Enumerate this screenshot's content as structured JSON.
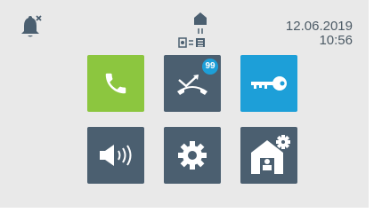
{
  "status": {
    "date": "12.06.2019",
    "time": "10:56"
  },
  "colors": {
    "call": "#8cc63f",
    "tile": "#4b5f70",
    "door": "#1d9fd8",
    "screen": "#e9e9e9"
  },
  "icons": {
    "notification": "bell-muted-icon",
    "connection": "building-link-icon",
    "call": "phone-icon",
    "missed_calls": "missed-call-icon",
    "door": "key-icon",
    "volume": "speaker-icon",
    "settings": "gear-icon",
    "building_settings": "building-gear-icon"
  },
  "tiles": {
    "missed_calls_count": "99"
  }
}
